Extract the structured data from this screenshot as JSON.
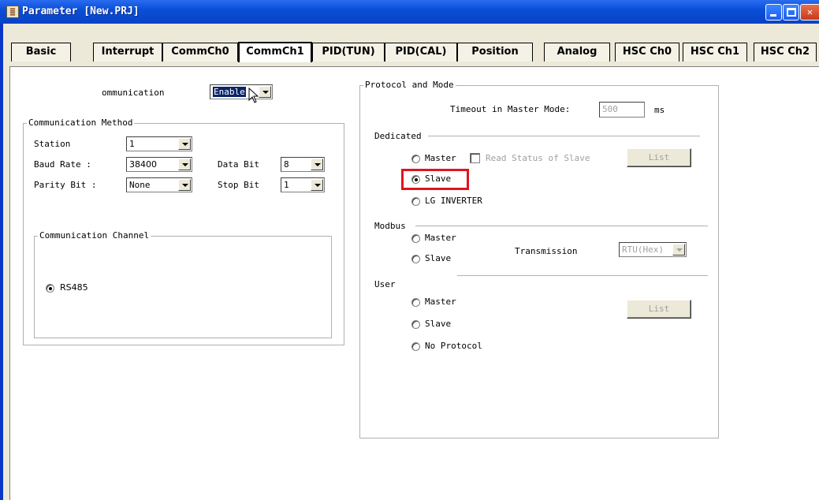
{
  "window": {
    "title": "Parameter [New.PRJ]",
    "icon": "app-icon"
  },
  "tabs": [
    "Basic",
    "Interrupt",
    "CommCh0",
    "CommCh1",
    "PID(TUN)",
    "PID(CAL)",
    "Position",
    "Analog",
    "HSC Ch0",
    "HSC Ch1",
    "HSC Ch2"
  ],
  "active_tab": "CommCh1",
  "communication": {
    "label": "ommunication",
    "value": "Enable"
  },
  "comm_method": {
    "legend": "Communication Method",
    "station_label": "Station",
    "station_value": "1",
    "baud_label": "Baud Rate :",
    "baud_value": "38400",
    "databit_label": "Data Bit",
    "databit_value": "8",
    "parity_label": "Parity Bit :",
    "parity_value": "None",
    "stopbit_label": "Stop Bit",
    "stopbit_value": "1"
  },
  "comm_channel": {
    "legend": "Communication Channel",
    "option": "RS485",
    "selected": true
  },
  "protocol": {
    "legend": "Protocol and Mode",
    "timeout_label": "Timeout in Master Mode:",
    "timeout_value": "500",
    "timeout_unit": "ms",
    "dedicated": {
      "label": "Dedicated",
      "master": "Master",
      "read_status": "Read Status of Slave",
      "list_button": "List",
      "slave": "Slave",
      "lg_inverter": "LG INVERTER",
      "selected": "Slave"
    },
    "modbus": {
      "label": "Modbus",
      "master": "Master",
      "slave": "Slave",
      "transmission_label": "Transmission",
      "transmission_value": "RTU(Hex)"
    },
    "user": {
      "label": "User",
      "master": "Master",
      "slave": "Slave",
      "no_protocol": "No Protocol",
      "list_button": "List"
    }
  },
  "colors": {
    "titlebar": "#0a4fd8",
    "highlight": "#e0141e",
    "dialog_bg": "#ece9d8"
  }
}
